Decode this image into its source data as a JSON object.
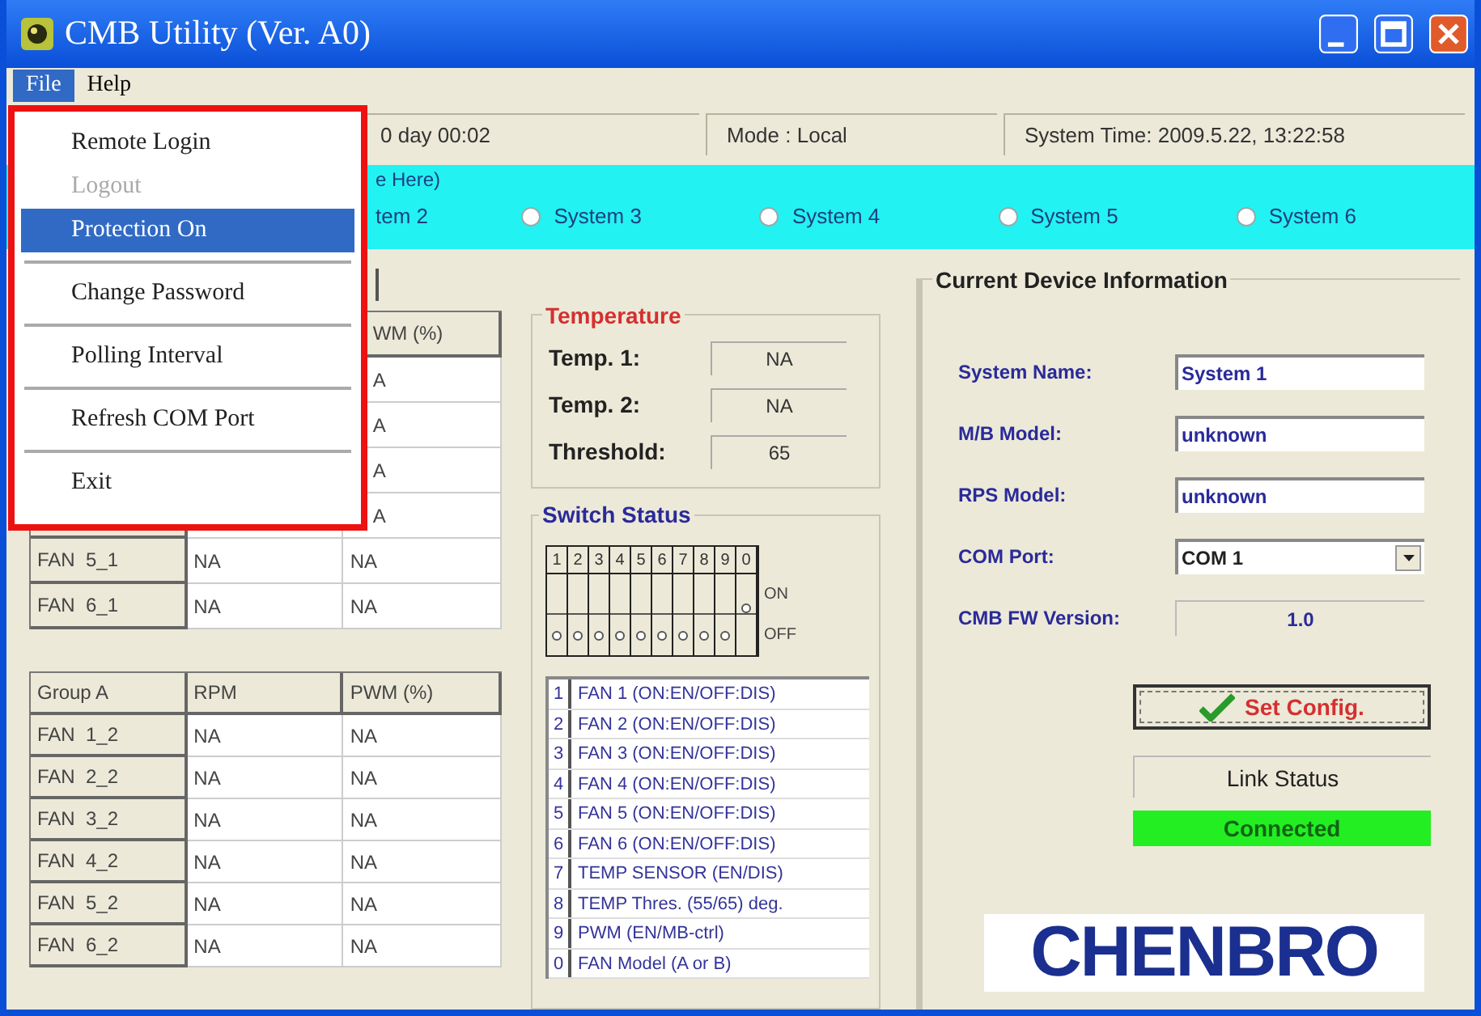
{
  "window": {
    "title": "CMB Utility (Ver. A0)"
  },
  "menu_bar": [
    {
      "label": "File",
      "selected": true
    },
    {
      "label": "Help",
      "selected": false
    }
  ],
  "file_menu": [
    {
      "kind": "item",
      "label": "Remote Login",
      "disabled": false,
      "selected": false
    },
    {
      "kind": "item",
      "label": "Logout",
      "disabled": true,
      "selected": false
    },
    {
      "kind": "item",
      "label": "Protection On",
      "disabled": false,
      "selected": true
    },
    {
      "kind": "separator"
    },
    {
      "kind": "item",
      "label": "Change Password",
      "disabled": false,
      "selected": false
    },
    {
      "kind": "separator"
    },
    {
      "kind": "item",
      "label": "Polling Interval",
      "disabled": false,
      "selected": false
    },
    {
      "kind": "separator"
    },
    {
      "kind": "item",
      "label": "Refresh COM Port",
      "disabled": false,
      "selected": false
    },
    {
      "kind": "separator"
    },
    {
      "kind": "item",
      "label": "Exit",
      "disabled": false,
      "selected": false
    }
  ],
  "status_bar": [
    "0 day 00:02",
    "Mode : Local",
    "System Time: 2009.5.22, 13:22:58"
  ],
  "system_group": {
    "title": "e Here)",
    "systems": [
      {
        "label": "tem 2"
      },
      {
        "label": "System 3",
        "selected": false
      },
      {
        "label": "System 4",
        "selected": false
      },
      {
        "label": "System 5",
        "selected": false
      },
      {
        "label": "System 6",
        "selected": false
      }
    ]
  },
  "fan_table_1": {
    "columns": [
      "WM (%)"
    ],
    "rows": [
      {
        "cells": [
          "A"
        ]
      },
      {
        "cells": [
          "A"
        ]
      },
      {
        "cells": [
          "A"
        ]
      },
      {
        "cells": [
          "A"
        ]
      },
      {
        "cells": [
          "FAN  5_1",
          "NA",
          "NA"
        ]
      },
      {
        "cells": [
          "FAN  6_1",
          "NA",
          "NA"
        ]
      }
    ]
  },
  "fan_table_2": {
    "columns": [
      "Group A",
      "RPM",
      "PWM (%)"
    ],
    "rows": [
      {
        "cells": [
          "FAN  1_2",
          "NA",
          "NA"
        ]
      },
      {
        "cells": [
          "FAN  2_2",
          "NA",
          "NA"
        ]
      },
      {
        "cells": [
          "FAN  3_2",
          "NA",
          "NA"
        ]
      },
      {
        "cells": [
          "FAN  4_2",
          "NA",
          "NA"
        ]
      },
      {
        "cells": [
          "FAN  5_2",
          "NA",
          "NA"
        ]
      },
      {
        "cells": [
          "FAN  6_2",
          "NA",
          "NA"
        ]
      }
    ]
  },
  "temperature": {
    "title": "Temperature",
    "rows": [
      {
        "label": "Temp. 1:",
        "value": "NA"
      },
      {
        "label": "Temp. 2:",
        "value": "NA"
      },
      {
        "label": "Threshold:",
        "value": "65"
      }
    ]
  },
  "switch_status": {
    "title": "Switch Status",
    "state_labels": [
      "ON",
      "OFF"
    ],
    "switches": [
      {
        "label": "1",
        "on": false
      },
      {
        "label": "2",
        "on": false
      },
      {
        "label": "3",
        "on": false
      },
      {
        "label": "4",
        "on": false
      },
      {
        "label": "5",
        "on": false
      },
      {
        "label": "6",
        "on": false
      },
      {
        "label": "7",
        "on": false
      },
      {
        "label": "8",
        "on": false
      },
      {
        "label": "9",
        "on": false
      },
      {
        "label": "0",
        "on": true
      }
    ],
    "legend": [
      {
        "number": "1",
        "text": "FAN 1 (ON:EN/OFF:DIS)"
      },
      {
        "number": "2",
        "text": "FAN 2 (ON:EN/OFF:DIS)"
      },
      {
        "number": "3",
        "text": "FAN 3 (ON:EN/OFF:DIS)"
      },
      {
        "number": "4",
        "text": "FAN 4 (ON:EN/OFF:DIS)"
      },
      {
        "number": "5",
        "text": "FAN 5 (ON:EN/OFF:DIS)"
      },
      {
        "number": "6",
        "text": "FAN 6 (ON:EN/OFF:DIS)"
      },
      {
        "number": "7",
        "text": "TEMP SENSOR (EN/DIS)"
      },
      {
        "number": "8",
        "text": "TEMP Thres. (55/65) deg."
      },
      {
        "number": "9",
        "text": "PWM (EN/MB-ctrl)"
      },
      {
        "number": "0",
        "text": "FAN Model (A or B)"
      }
    ]
  },
  "device_info": {
    "title": "Current Device Information",
    "fields": [
      {
        "kind": "input",
        "label": "System Name:",
        "value": "System 1"
      },
      {
        "kind": "input",
        "label": "M/B Model:",
        "value": "unknown"
      },
      {
        "kind": "input",
        "label": "RPS Model:",
        "value": "unknown"
      },
      {
        "kind": "select",
        "label": "COM Port:",
        "value": "COM 1"
      },
      {
        "kind": "readonly",
        "label": "CMB FW Version:",
        "value": "1.0"
      }
    ],
    "set_button": "Set Config.",
    "link_status": {
      "label": "Link Status",
      "value": "Connected",
      "connected": true
    },
    "logo": "CHENBRO"
  }
}
